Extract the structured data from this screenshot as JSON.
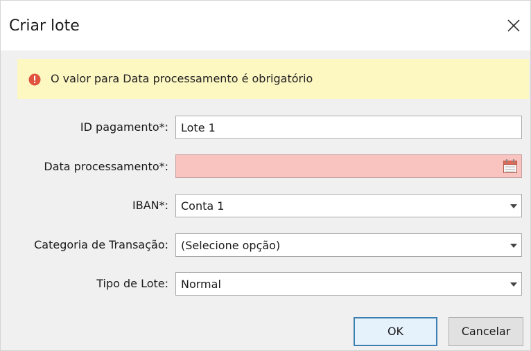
{
  "dialog": {
    "title": "Criar lote",
    "close_icon": "close-icon"
  },
  "error": {
    "icon": "error-icon",
    "message": "O valor para Data processamento é obrigatório",
    "color": "#e0533f"
  },
  "form": {
    "payment_id": {
      "label": "ID pagamento*:",
      "value": "Lote 1"
    },
    "processing_date": {
      "label": "Data processamento*:",
      "value": "",
      "icon": "calendar-icon"
    },
    "iban": {
      "label": "IBAN*:",
      "value": "Conta 1"
    },
    "transaction_category": {
      "label": "Categoria de Transação:",
      "value": "(Selecione opção)"
    },
    "batch_type": {
      "label": "Tipo de Lote:",
      "value": "Normal"
    }
  },
  "buttons": {
    "ok_label": "OK",
    "cancel_label": "Cancelar"
  }
}
